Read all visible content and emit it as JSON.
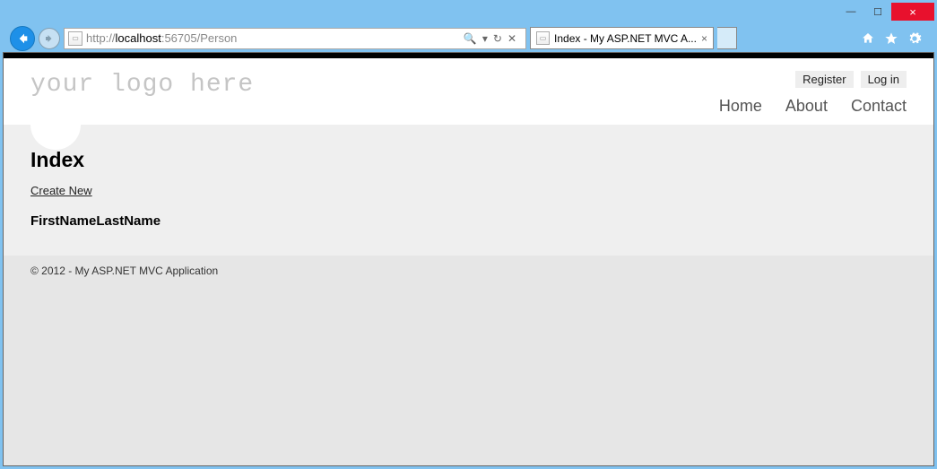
{
  "window": {
    "min_label": "—",
    "max_label": "☐",
    "close_label": "×"
  },
  "browser": {
    "url_prefix": "http://",
    "url_host": "localhost",
    "url_port": ":56705",
    "url_path": "/Person",
    "search_glyph": "🔍",
    "dropdown_glyph": "▾",
    "refresh_glyph": "↻",
    "stop_glyph": "✕",
    "tab_title": "Index - My ASP.NET MVC A...",
    "tab_close": "×"
  },
  "site": {
    "logo": "your logo here",
    "auth": {
      "register": "Register",
      "login": "Log in"
    },
    "nav": {
      "home": "Home",
      "about": "About",
      "contact": "Contact"
    }
  },
  "page": {
    "heading": "Index",
    "create_link": "Create New",
    "columns": {
      "first": "FirstName",
      "last": "LastName"
    }
  },
  "footer": {
    "text": "© 2012 - My ASP.NET MVC Application"
  }
}
